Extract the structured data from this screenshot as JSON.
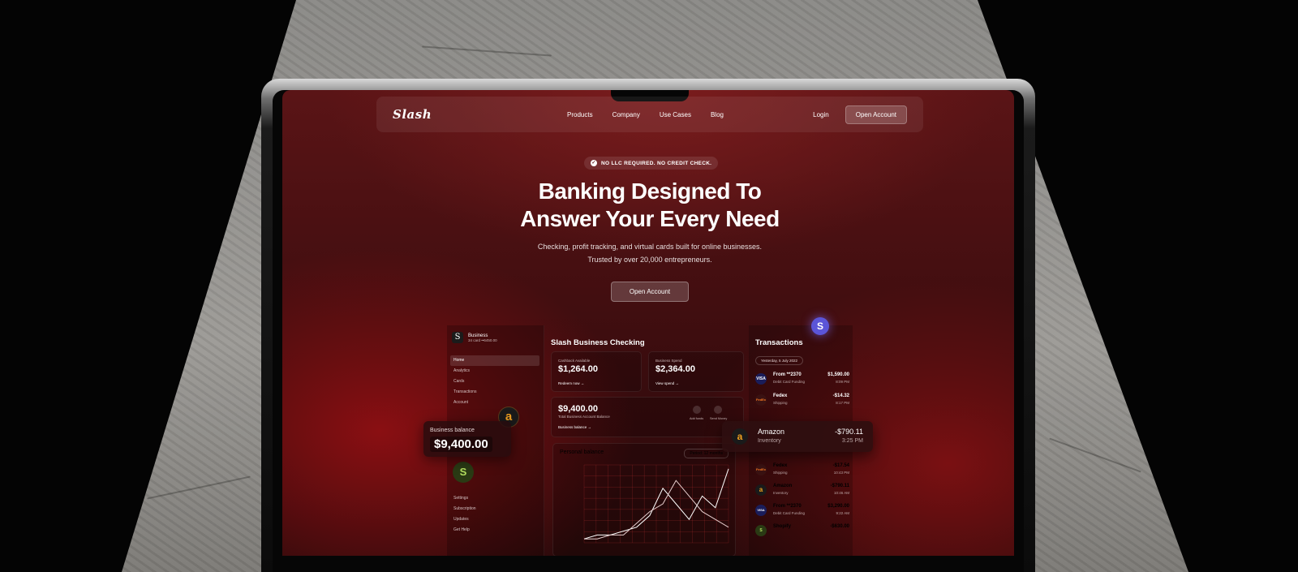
{
  "nav": {
    "logo": "Slash",
    "links": [
      "Products",
      "Company",
      "Use Cases",
      "Blog"
    ],
    "login": "Login",
    "open_account": "Open Account"
  },
  "badge": "NO LLC REQUIRED. NO CREDIT CHECK.",
  "hero": {
    "title_line1": "Banking Designed To",
    "title_line2": "Answer Your Every Need",
    "subtitle_line1": "Checking, profit tracking, and virtual cards built for online businesses.",
    "subtitle_line2": "Trusted by over 20,000 entrepreneurs.",
    "cta": "Open Account"
  },
  "dashboard": {
    "account_name": "Business",
    "account_sub": "34 card ••6450.00",
    "menu": [
      "Home",
      "Analytics",
      "Cards",
      "Transactions",
      "Account"
    ],
    "menu_bottom": [
      "Settings",
      "Subscription",
      "Updates",
      "Get Help"
    ],
    "title": "Slash Business Checking",
    "cashback_label": "Cashback Available",
    "cashback_value": "$1,264.00",
    "cashback_link": "Redeem now →",
    "spend_label": "Business Spend",
    "spend_value": "$2,364.00",
    "spend_link": "View spend →",
    "balance_value": "$9,400.00",
    "balance_label": "Total Business Account Balance",
    "balance_link": "Business balance →",
    "add_funds": "Add funds",
    "send_money": "Send Money",
    "personal_balance": "Personal balance",
    "period": "Period: 12 months"
  },
  "transactions": {
    "title": "Transactions",
    "date": "Yesterday, 5 July 2022",
    "rows": [
      {
        "name": "From **2370",
        "category": "Debit Card Funding",
        "amount": "$1,590.00",
        "time": "8:09 PM",
        "logo": "VISA"
      },
      {
        "name": "Fedex",
        "category": "Shipping",
        "amount": "-$14.32",
        "time": "8:17 PM",
        "logo": "FedEx"
      },
      {
        "name": "Fedex",
        "category": "Shipping",
        "amount": "-$17.54",
        "time": "10:43 PM",
        "logo": "FedEx"
      },
      {
        "name": "Amazon",
        "category": "Inventory",
        "amount": "-$790.11",
        "time": "10:46 AM",
        "logo": "a"
      },
      {
        "name": "From **2370",
        "category": "Debit Card Funding",
        "amount": "$3,290.00",
        "time": "9:22 AM",
        "logo": "VISA"
      },
      {
        "name": "Shopify",
        "category": "",
        "amount": "-$630.00",
        "time": "",
        "logo": "S"
      }
    ]
  },
  "floating_balance": {
    "label": "Business balance",
    "value": "$9,400.00"
  },
  "floating_tx": {
    "name": "Amazon",
    "category": "Inventory",
    "amount": "-$790.11",
    "time": "3:25 PM"
  },
  "chart_data": {
    "type": "line",
    "series": [
      {
        "values": [
          1,
          2,
          2,
          3,
          4,
          7,
          14,
          10,
          6,
          12,
          9,
          19
        ]
      },
      {
        "values": [
          1,
          1,
          2,
          2,
          5,
          8,
          10,
          16,
          12,
          8,
          6,
          4
        ]
      }
    ],
    "ylim": [
      0,
      20
    ]
  },
  "colors": {
    "accent": "#5b55d8",
    "background": "#3a0c0e"
  }
}
